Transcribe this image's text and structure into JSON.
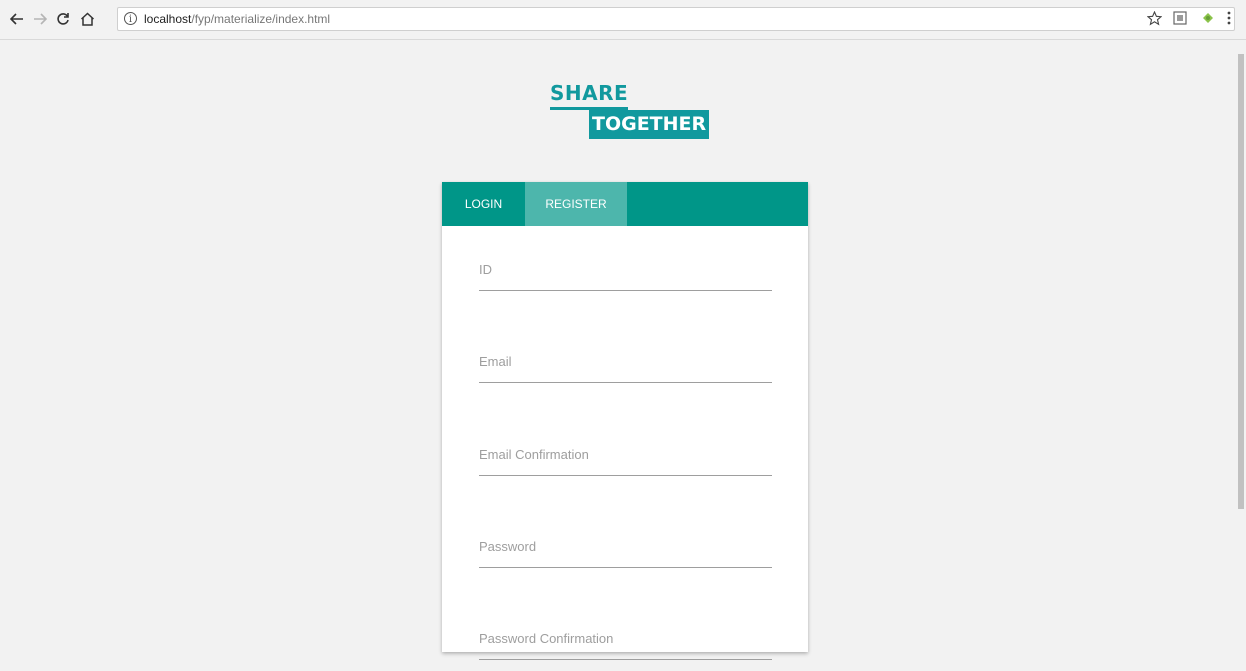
{
  "browser": {
    "url_host": "localhost",
    "url_path": "/fyp/materialize/index.html",
    "info_glyph": "i",
    "icons": {
      "back": "back-arrow-icon",
      "forward": "forward-arrow-icon",
      "reload": "reload-icon",
      "home": "home-icon",
      "bookmark": "star-icon",
      "extension": "extension-icon",
      "android": "android-icon",
      "menu": "kebab-menu-icon"
    }
  },
  "logo": {
    "line1": "SHARE",
    "line2": "TOGETHER",
    "color": "#11999e"
  },
  "tabs": {
    "login": "LOGIN",
    "register": "REGISTER",
    "bar_color": "#009688",
    "active_color": "#4db6ac"
  },
  "form": {
    "fields": [
      {
        "label": "ID"
      },
      {
        "label": "Email"
      },
      {
        "label": "Email Confirmation"
      },
      {
        "label": "Password"
      },
      {
        "label": "Password Confirmation"
      }
    ]
  }
}
